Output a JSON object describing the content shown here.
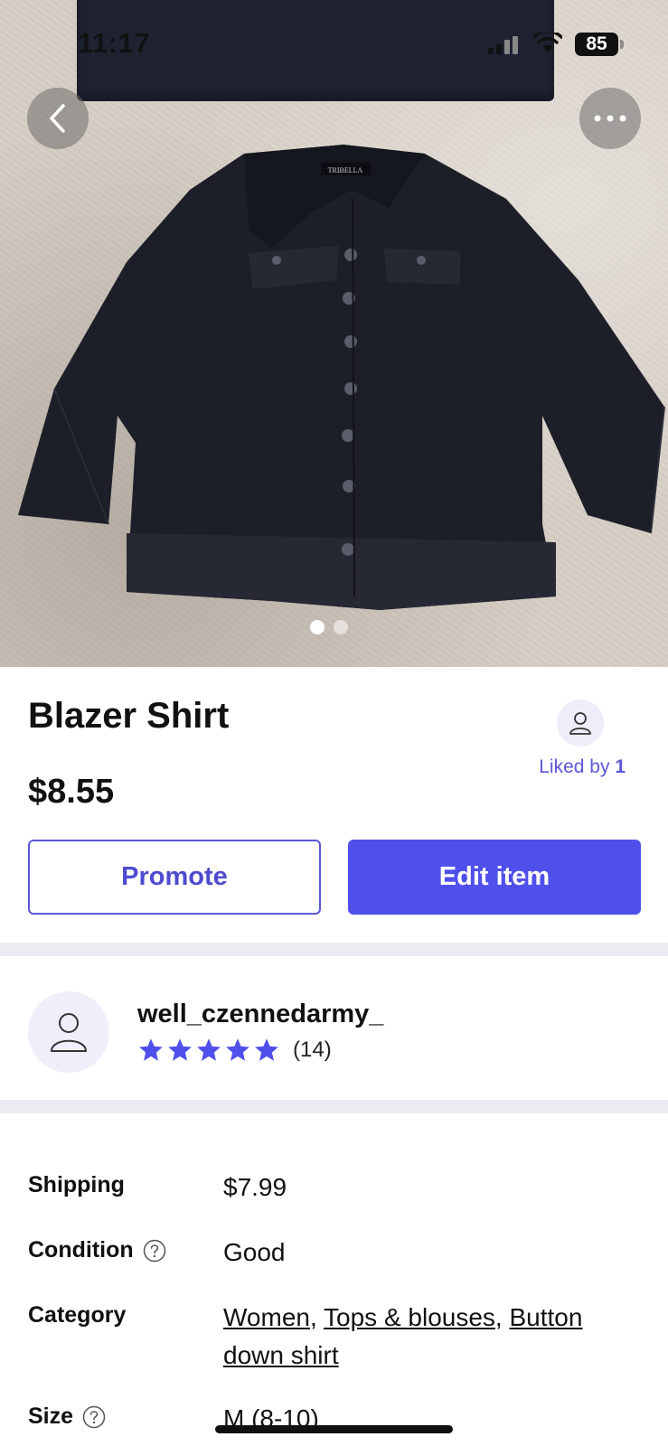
{
  "status_bar": {
    "time": "11:17",
    "battery": "85"
  },
  "photo": {
    "page_count": 2,
    "active_page": 1,
    "jacket_label": "TRIBELLA"
  },
  "item": {
    "title": "Blazer Shirt",
    "price": "$8.55",
    "liked_prefix": "Liked by",
    "liked_count": "1"
  },
  "actions": {
    "promote_label": "Promote",
    "edit_label": "Edit item"
  },
  "seller": {
    "username": "well_czennedarmy_",
    "rating_stars": 5,
    "review_count": "(14)"
  },
  "details": {
    "shipping_label": "Shipping",
    "shipping_value": "$7.99",
    "condition_label": "Condition",
    "condition_value": "Good",
    "category_label": "Category",
    "category_links": [
      "Women",
      "Tops & blouses",
      "Button down shirt"
    ],
    "category_separator": ", ",
    "size_label": "Size",
    "size_value": "M (8-10)"
  },
  "colors": {
    "accent": "#4f50ec",
    "accent_text": "#5b57d6",
    "divider": "#ecebf1"
  }
}
